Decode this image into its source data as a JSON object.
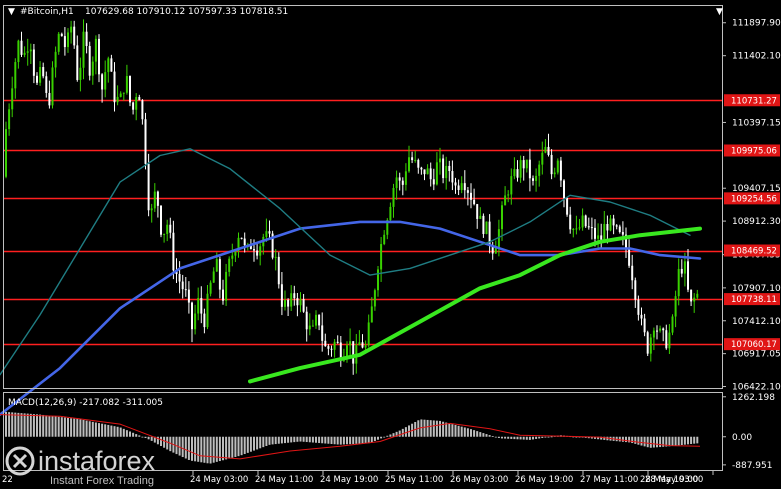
{
  "header": {
    "arrow": "▼",
    "symbol": "#Bitcoin,H1",
    "ohlc": "107629.68 107910.12 107597.33 107818.51"
  },
  "macd_header": "MACD(12,26,9) -217.082 -311.005",
  "price_axis": [
    "111897.90",
    "111402.10",
    "110397.15",
    "109407.15",
    "108912.30",
    "108407.35",
    "107907.10",
    "107412.10",
    "106917.05",
    "106422.10"
  ],
  "levels": [
    {
      "price": 110731.27,
      "label": "110731.27"
    },
    {
      "price": 109975.06,
      "label": "109975.06"
    },
    {
      "price": 109254.56,
      "label": "109254.56"
    },
    {
      "price": 108469.52,
      "label": "108469.52"
    },
    {
      "price": 107738.11,
      "label": "107738.11"
    },
    {
      "price": 107060.17,
      "label": "107060.17"
    }
  ],
  "macd_axis": [
    "1262.198",
    "0.00",
    "-887.951"
  ],
  "time_axis": [
    "24 May 03:00",
    "24 May 11:00",
    "24 May 19:00",
    "25 May 11:00",
    "26 May 03:00",
    "26 May 19:00",
    "27 May 11:00",
    "28 May 03:00",
    "28 May 19:00"
  ],
  "time_axis_partial": "22",
  "watermark": {
    "brand": "instaforex",
    "tagline": "Instant Forex Trading"
  },
  "colors": {
    "background": "#000000",
    "bull_candle": "#39d100",
    "bear_candle": "#ffffff",
    "level_line": "#ff1f1f",
    "level_tag": "#e01515",
    "ma_fast": "#4466e8",
    "ma_mid": "#1f7d83",
    "ma_slow": "#39e81f",
    "macd_hist": "#bdbdbd",
    "macd_signal": "#e01515",
    "axis": "#bfbfbf"
  },
  "chart_data": {
    "type": "candlestick",
    "instrument": "#Bitcoin",
    "timeframe": "H1",
    "ylim": [
      106400,
      112150
    ],
    "x_ticks": [
      "24 May 03:00",
      "24 May 11:00",
      "24 May 19:00",
      "25 May 11:00",
      "26 May 03:00",
      "26 May 19:00",
      "27 May 11:00",
      "28 May 03:00",
      "28 May 19:00"
    ],
    "close_path": [
      [
        0,
        109700
      ],
      [
        6,
        110300
      ],
      [
        12,
        111000
      ],
      [
        18,
        111600
      ],
      [
        24,
        111400
      ],
      [
        30,
        111700
      ],
      [
        36,
        110900
      ],
      [
        42,
        111200
      ],
      [
        48,
        110600
      ],
      [
        54,
        111300
      ],
      [
        60,
        111800
      ],
      [
        66,
        111500
      ],
      [
        72,
        111900
      ],
      [
        78,
        111000
      ],
      [
        84,
        111700
      ],
      [
        90,
        111200
      ],
      [
        96,
        111600
      ],
      [
        102,
        110900
      ],
      [
        108,
        111400
      ],
      [
        114,
        110800
      ],
      [
        120,
        110700
      ],
      [
        126,
        111100
      ],
      [
        132,
        110500
      ],
      [
        138,
        111000
      ],
      [
        144,
        110200
      ],
      [
        150,
        108900
      ],
      [
        156,
        109400
      ],
      [
        162,
        108700
      ],
      [
        168,
        108900
      ],
      [
        174,
        108200
      ],
      [
        180,
        108000
      ],
      [
        186,
        107800
      ],
      [
        192,
        107300
      ],
      [
        198,
        107700
      ],
      [
        204,
        107400
      ],
      [
        210,
        107900
      ],
      [
        216,
        108300
      ],
      [
        222,
        107700
      ],
      [
        228,
        108200
      ],
      [
        234,
        108500
      ],
      [
        240,
        108800
      ],
      [
        246,
        108400
      ],
      [
        252,
        108600
      ],
      [
        258,
        108500
      ],
      [
        264,
        108700
      ],
      [
        270,
        108600
      ],
      [
        276,
        108300
      ],
      [
        282,
        107700
      ],
      [
        288,
        107600
      ],
      [
        294,
        107800
      ],
      [
        300,
        107700
      ],
      [
        306,
        107400
      ],
      [
        312,
        107200
      ],
      [
        318,
        107500
      ],
      [
        324,
        107000
      ],
      [
        330,
        107000
      ],
      [
        336,
        107100
      ],
      [
        342,
        106900
      ],
      [
        348,
        107200
      ],
      [
        354,
        106800
      ],
      [
        360,
        107100
      ],
      [
        366,
        107000
      ],
      [
        372,
        107600
      ],
      [
        378,
        108300
      ],
      [
        384,
        108800
      ],
      [
        390,
        109200
      ],
      [
        396,
        109600
      ],
      [
        402,
        109400
      ],
      [
        408,
        109900
      ],
      [
        414,
        109800
      ],
      [
        420,
        109600
      ],
      [
        426,
        109700
      ],
      [
        432,
        109500
      ],
      [
        438,
        109800
      ],
      [
        444,
        109600
      ],
      [
        450,
        109700
      ],
      [
        456,
        109400
      ],
      [
        462,
        109600
      ],
      [
        468,
        109400
      ],
      [
        474,
        109200
      ],
      [
        480,
        108900
      ],
      [
        486,
        108800
      ],
      [
        492,
        108500
      ],
      [
        498,
        108700
      ],
      [
        504,
        109200
      ],
      [
        510,
        109500
      ],
      [
        516,
        109600
      ],
      [
        522,
        109800
      ],
      [
        528,
        109700
      ],
      [
        534,
        109400
      ],
      [
        540,
        109800
      ],
      [
        546,
        110000
      ],
      [
        552,
        109600
      ],
      [
        558,
        109900
      ],
      [
        564,
        109300
      ],
      [
        570,
        108900
      ],
      [
        576,
        108700
      ],
      [
        582,
        108900
      ],
      [
        588,
        108800
      ],
      [
        594,
        108700
      ],
      [
        600,
        108600
      ],
      [
        606,
        108900
      ],
      [
        612,
        108800
      ],
      [
        618,
        108700
      ],
      [
        624,
        108600
      ],
      [
        630,
        108300
      ],
      [
        636,
        107800
      ],
      [
        642,
        107300
      ],
      [
        648,
        107000
      ],
      [
        654,
        107400
      ],
      [
        660,
        107200
      ],
      [
        666,
        107100
      ],
      [
        672,
        107300
      ],
      [
        678,
        108100
      ],
      [
        684,
        108300
      ],
      [
        690,
        107600
      ],
      [
        696,
        107800
      ]
    ],
    "series": [
      {
        "type": "line",
        "role": "ma_fast",
        "points": [
          [
            0,
            106000
          ],
          [
            60,
            106700
          ],
          [
            120,
            107600
          ],
          [
            180,
            108200
          ],
          [
            240,
            108500
          ],
          [
            300,
            108800
          ],
          [
            360,
            108900
          ],
          [
            400,
            108900
          ],
          [
            440,
            108800
          ],
          [
            480,
            108600
          ],
          [
            520,
            108400
          ],
          [
            560,
            108400
          ],
          [
            600,
            108500
          ],
          [
            630,
            108500
          ],
          [
            660,
            108400
          ],
          [
            700,
            108350
          ]
        ]
      },
      {
        "type": "line",
        "role": "ma_mid",
        "points": [
          [
            0,
            106600
          ],
          [
            40,
            107500
          ],
          [
            80,
            108500
          ],
          [
            120,
            109500
          ],
          [
            160,
            109900
          ],
          [
            190,
            110000
          ],
          [
            230,
            109700
          ],
          [
            280,
            109100
          ],
          [
            330,
            108400
          ],
          [
            370,
            108100
          ],
          [
            410,
            108200
          ],
          [
            450,
            108400
          ],
          [
            490,
            108600
          ],
          [
            530,
            108900
          ],
          [
            570,
            109300
          ],
          [
            610,
            109200
          ],
          [
            650,
            109000
          ],
          [
            690,
            108700
          ]
        ]
      },
      {
        "type": "line",
        "role": "ma_slow",
        "points": [
          [
            250,
            106500
          ],
          [
            300,
            106700
          ],
          [
            360,
            106900
          ],
          [
            420,
            107400
          ],
          [
            480,
            107900
          ],
          [
            520,
            108100
          ],
          [
            560,
            108400
          ],
          [
            600,
            108600
          ],
          [
            640,
            108700
          ],
          [
            700,
            108800
          ]
        ]
      }
    ],
    "macd": {
      "ylim": [
        -1050,
        1350
      ],
      "histogram_path": [
        [
          0,
          800
        ],
        [
          40,
          700
        ],
        [
          80,
          550
        ],
        [
          120,
          300
        ],
        [
          150,
          -100
        ],
        [
          170,
          -450
        ],
        [
          190,
          -750
        ],
        [
          210,
          -850
        ],
        [
          240,
          -600
        ],
        [
          270,
          -250
        ],
        [
          300,
          -150
        ],
        [
          340,
          -250
        ],
        [
          370,
          -200
        ],
        [
          400,
          200
        ],
        [
          420,
          550
        ],
        [
          440,
          500
        ],
        [
          470,
          250
        ],
        [
          500,
          -50
        ],
        [
          530,
          -100
        ],
        [
          560,
          50
        ],
        [
          590,
          -50
        ],
        [
          610,
          -120
        ],
        [
          630,
          -180
        ],
        [
          650,
          -350
        ],
        [
          670,
          -300
        ],
        [
          700,
          -200
        ]
      ],
      "signal_path": [
        [
          0,
          700
        ],
        [
          60,
          650
        ],
        [
          120,
          400
        ],
        [
          170,
          -200
        ],
        [
          200,
          -600
        ],
        [
          240,
          -700
        ],
        [
          290,
          -450
        ],
        [
          340,
          -300
        ],
        [
          380,
          -150
        ],
        [
          420,
          280
        ],
        [
          450,
          420
        ],
        [
          490,
          250
        ],
        [
          520,
          50
        ],
        [
          560,
          20
        ],
        [
          600,
          -10
        ],
        [
          640,
          -180
        ],
        [
          670,
          -280
        ],
        [
          700,
          -300
        ]
      ],
      "macd_value": -217.082,
      "signal_value": -311.005
    }
  }
}
